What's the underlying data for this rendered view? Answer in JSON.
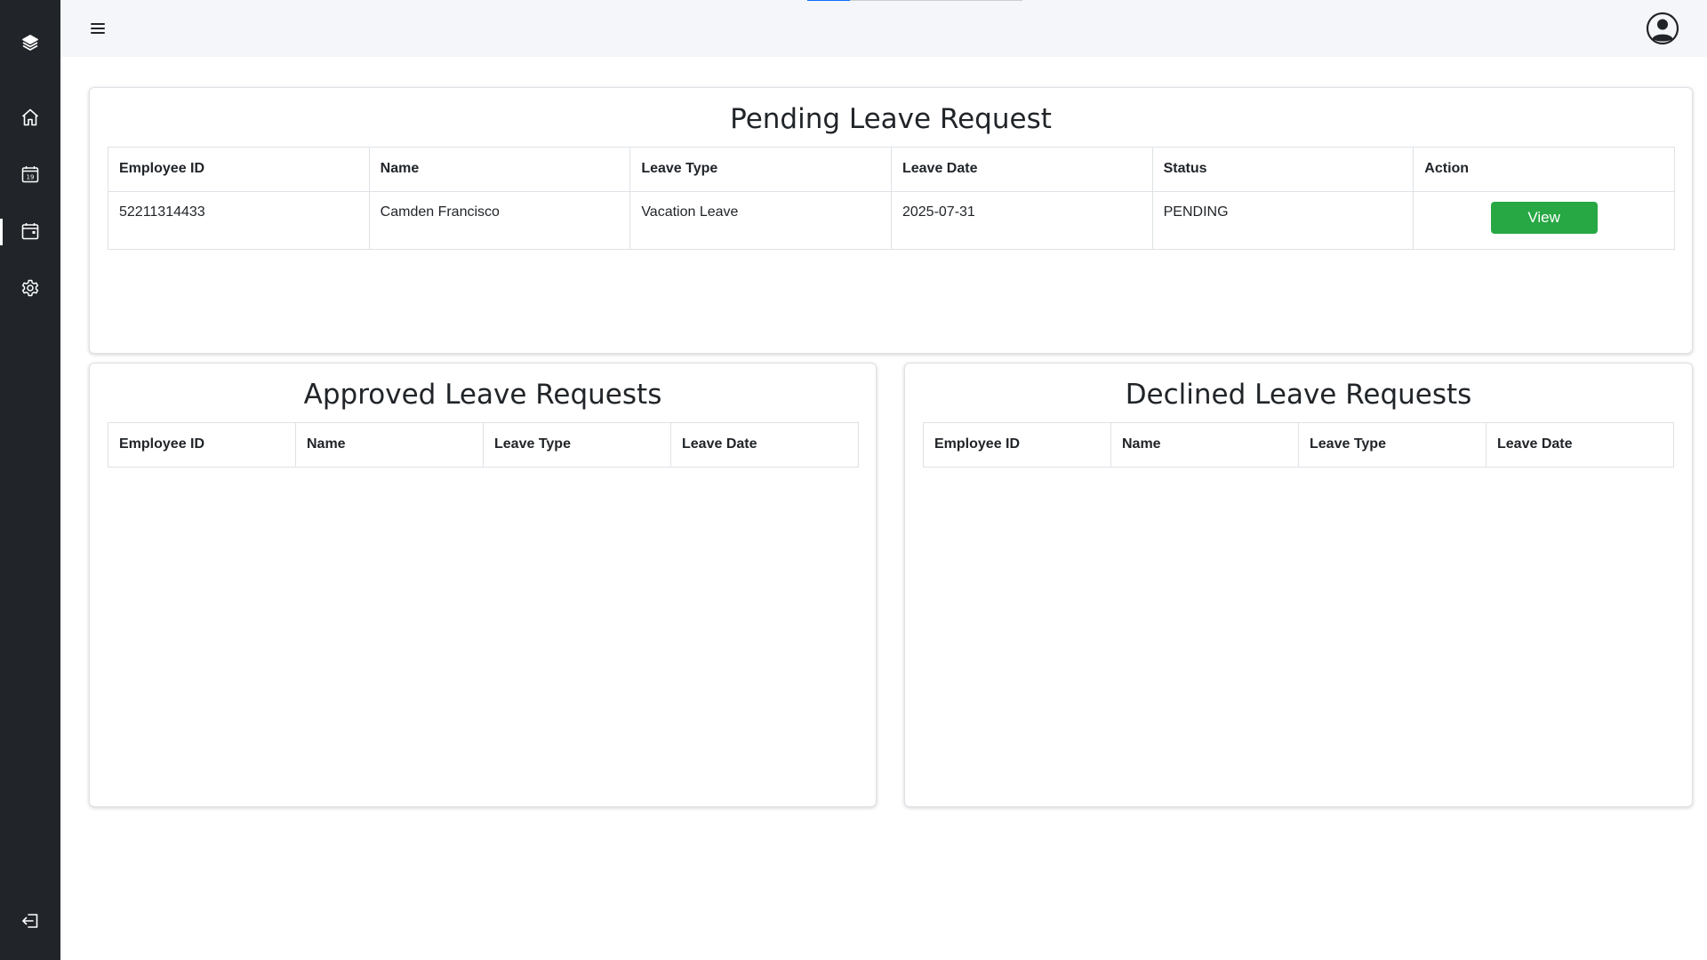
{
  "sidebar": {
    "items": [
      {
        "name": "logo",
        "icon": "stack-icon"
      },
      {
        "name": "home",
        "icon": "home-icon"
      },
      {
        "name": "calendar",
        "icon": "calendar-19-icon"
      },
      {
        "name": "leave",
        "icon": "calendar-icon",
        "active": true
      },
      {
        "name": "settings",
        "icon": "gear-icon"
      },
      {
        "name": "logout",
        "icon": "logout-icon"
      }
    ]
  },
  "topbar": {
    "menu_icon": "hamburger-icon",
    "account_icon": "user-circle-icon",
    "progress": 0.2
  },
  "pending": {
    "title": "Pending Leave Request",
    "columns": [
      "Employee ID",
      "Name",
      "Leave Type",
      "Leave Date",
      "Status",
      "Action"
    ],
    "rows": [
      {
        "employee_id": "52211314433",
        "name": "Camden Francisco",
        "leave_type": "Vacation Leave",
        "leave_date": "2025-07-31",
        "status": "PENDING",
        "action": "View"
      }
    ]
  },
  "approved": {
    "title": "Approved Leave Requests",
    "columns": [
      "Employee ID",
      "Name",
      "Leave Type",
      "Leave Date"
    ],
    "rows": []
  },
  "declined": {
    "title": "Declined Leave Requests",
    "columns": [
      "Employee ID",
      "Name",
      "Leave Type",
      "Leave Date"
    ],
    "rows": []
  },
  "colors": {
    "sidebar_bg": "#212529",
    "topbar_bg": "#f5f6f9",
    "view_button": "#28a745",
    "progress": "#0d6efd"
  }
}
